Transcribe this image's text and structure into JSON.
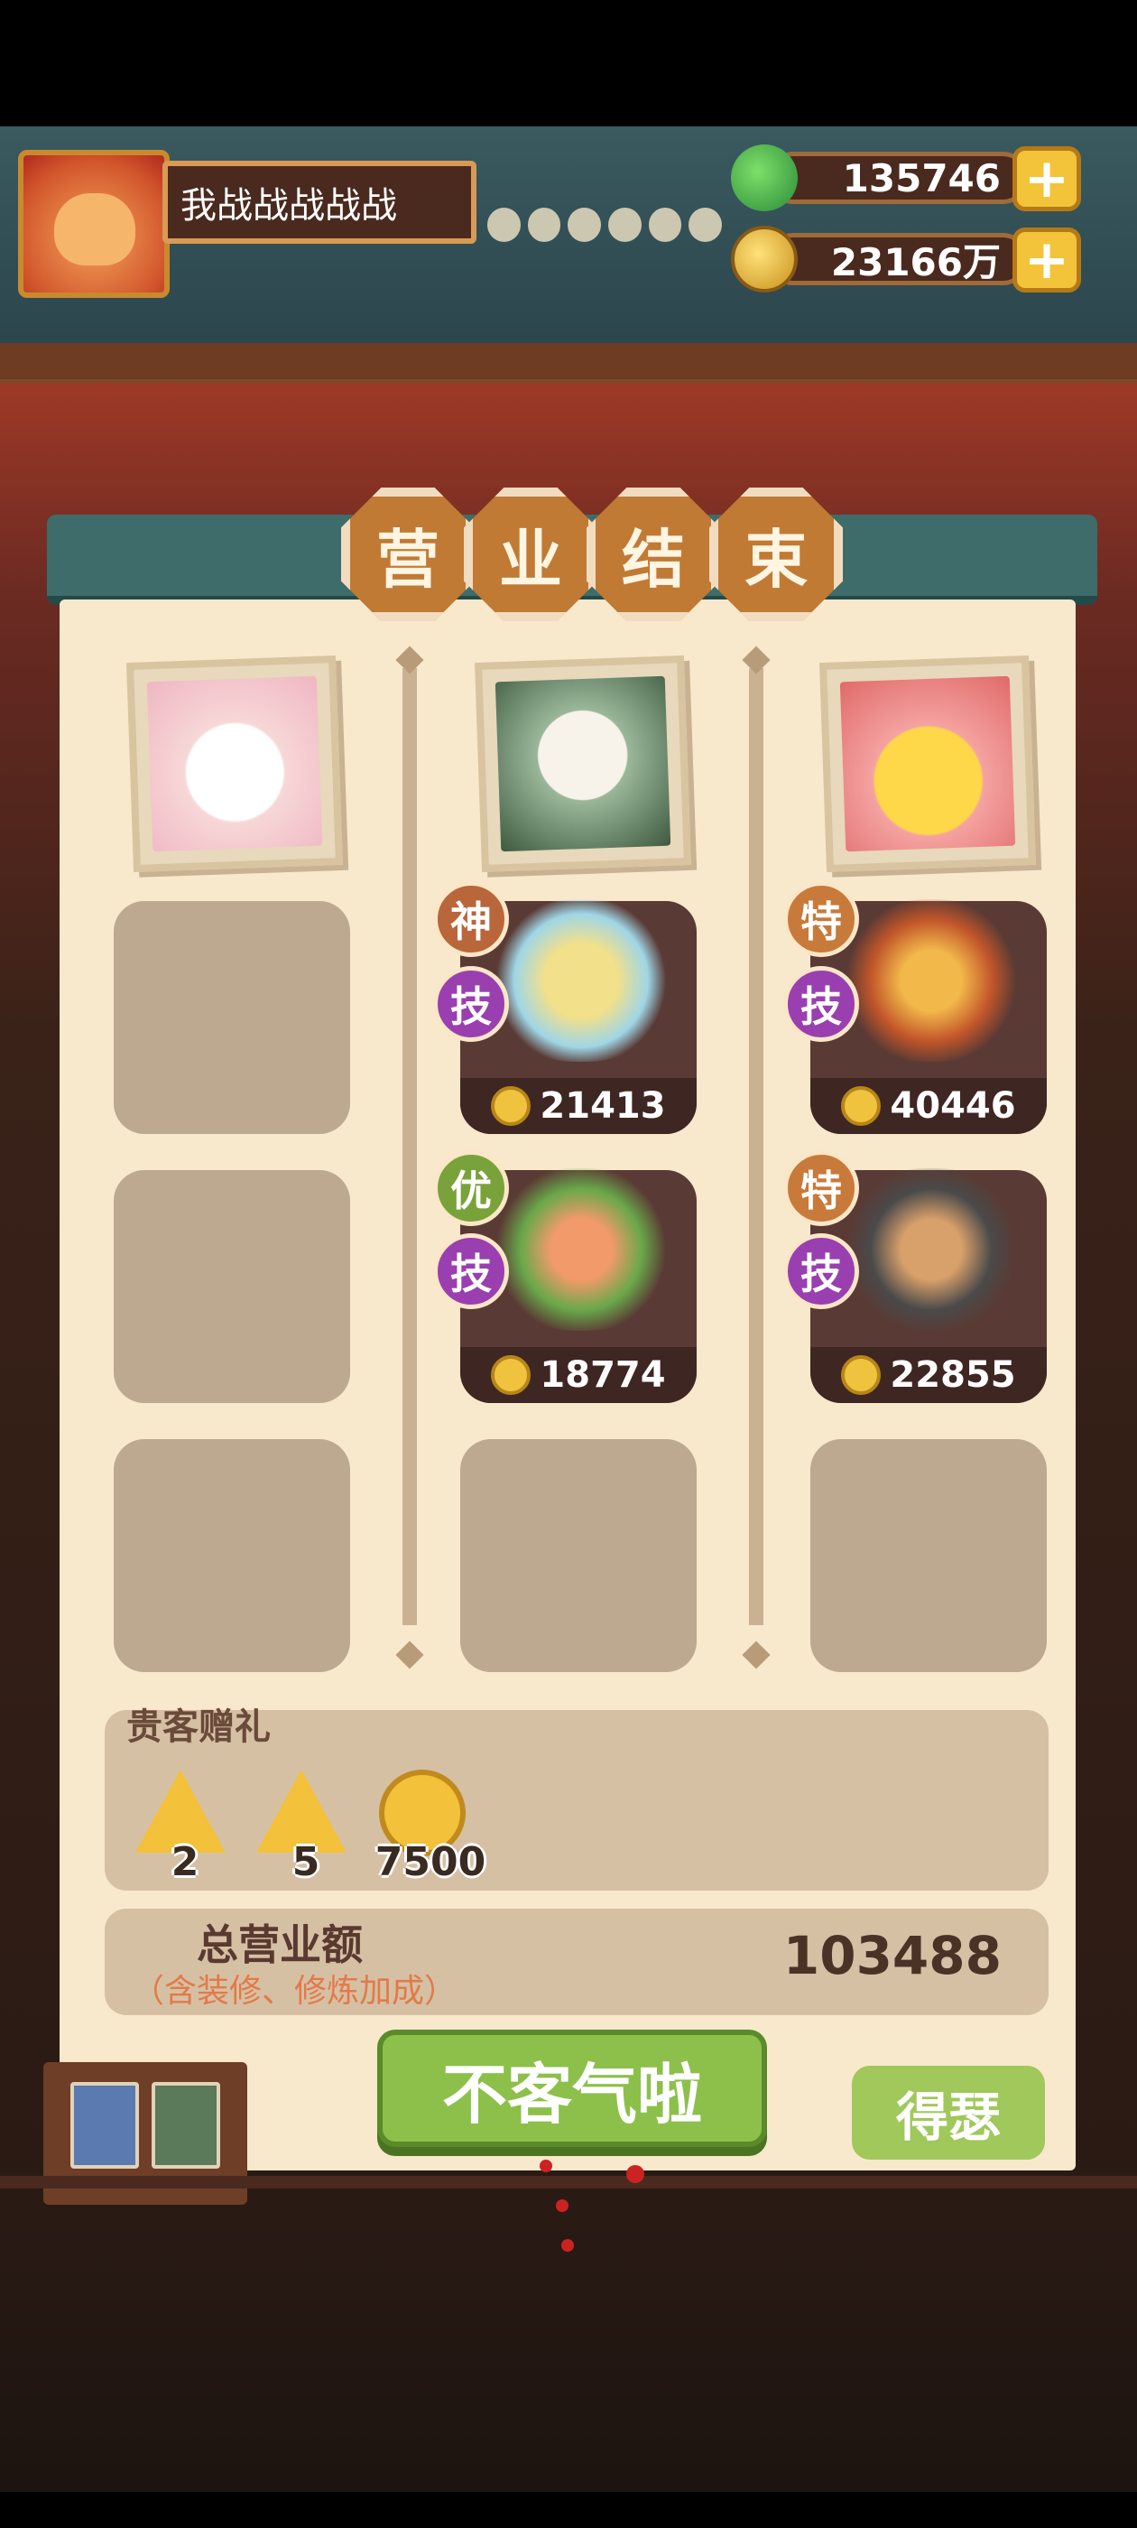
{
  "player": {
    "name": "我战战战战战"
  },
  "resources": [
    {
      "id": "jade",
      "value": "135746",
      "plus": "+",
      "color": "#3aa84a"
    },
    {
      "id": "gold",
      "value": "23166万",
      "plus": "+",
      "color": "#f0c33e"
    }
  ],
  "title_chars": [
    "营",
    "业",
    "结",
    "束"
  ],
  "dishes": [
    {
      "rank": "神",
      "skill": "技",
      "price": "21413"
    },
    {
      "rank": "优",
      "skill": "技",
      "price": "18774"
    },
    {
      "rank": "特",
      "skill": "技",
      "price": "40446"
    },
    {
      "rank": "特",
      "skill": "技",
      "price": "22855"
    }
  ],
  "gifts": {
    "label": "贵客赠礼",
    "items": [
      {
        "icon": "ticket-gift-icon",
        "count": "2"
      },
      {
        "icon": "dish-gift-icon",
        "count": "5"
      },
      {
        "icon": "coin-icon",
        "count": "7500"
      }
    ]
  },
  "total": {
    "label": "总营业额",
    "sublabel": "（含装修、修炼加成）",
    "value": "103488"
  },
  "buttons": {
    "decline": "不客气啦",
    "share": "得瑟"
  }
}
